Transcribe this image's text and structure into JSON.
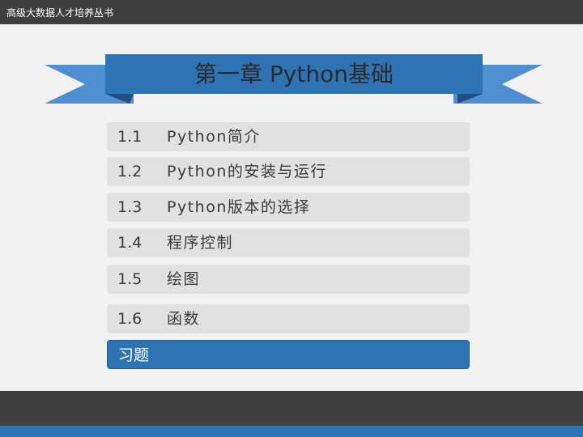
{
  "header": {
    "series_title": "高级大数据人才培养丛书"
  },
  "banner": {
    "title": "第一章   Python基础"
  },
  "toc": {
    "items": [
      {
        "num": "1.1",
        "label": "Python简介"
      },
      {
        "num": "1.2",
        "label": "Python的安装与运行"
      },
      {
        "num": "1.3",
        "label": "Python版本的选择"
      },
      {
        "num": "1.4",
        "label": "程序控制"
      },
      {
        "num": "1.5",
        "label": "绘图"
      },
      {
        "num": "1.6",
        "label": "函数"
      }
    ],
    "active_item": {
      "label": "习题"
    }
  },
  "colors": {
    "accent": "#2e74b5",
    "dark_bar": "#3f3f3f",
    "row_bg": "#e1e1e1"
  }
}
